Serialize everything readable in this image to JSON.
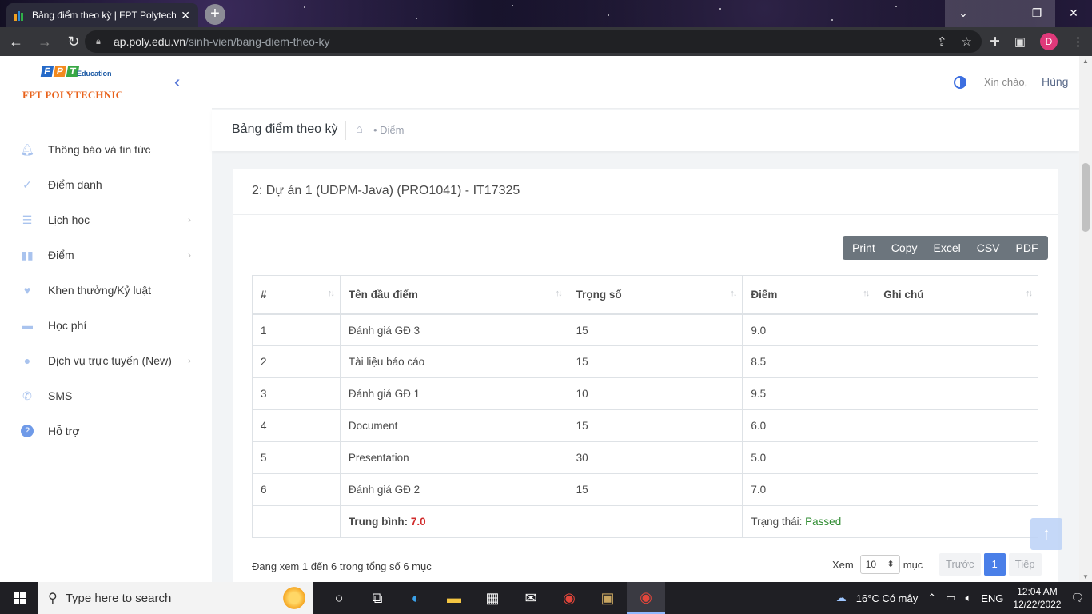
{
  "browser": {
    "tab_title": "Bảng điểm theo kỳ | FPT Polytech",
    "url_host": "ap.poly.edu.vn",
    "url_path": "/sinh-vien/bang-diem-theo-ky",
    "profile_initial": "D"
  },
  "sidebar": {
    "logo_letters": [
      "F",
      "P",
      "T"
    ],
    "logo_education": "Education",
    "logo_text": "FPT POLYTECHNIC",
    "items": [
      {
        "label": "Thông báo và tin tức",
        "icon": "bell-icon",
        "has_submenu": false
      },
      {
        "label": "Điểm danh",
        "icon": "check-icon",
        "has_submenu": false
      },
      {
        "label": "Lịch học",
        "icon": "list-icon",
        "has_submenu": true
      },
      {
        "label": "Điểm",
        "icon": "book-icon",
        "has_submenu": true
      },
      {
        "label": "Khen thưởng/Kỷ luật",
        "icon": "heart-icon",
        "has_submenu": false
      },
      {
        "label": "Học phí",
        "icon": "wallet-icon",
        "has_submenu": false
      },
      {
        "label": "Dịch vụ trực tuyến (New)",
        "icon": "globe-icon",
        "has_submenu": true
      },
      {
        "label": "SMS",
        "icon": "phone-icon",
        "has_submenu": false
      },
      {
        "label": "Hỗ trợ",
        "icon": "help-icon",
        "has_submenu": false
      }
    ]
  },
  "header": {
    "greeting": "Xin chào,",
    "user_name": "Hùng"
  },
  "breadcrumb": {
    "page_title": "Bảng điểm theo kỳ",
    "current": "Điểm"
  },
  "card": {
    "title": "2: Dự án 1 (UDPM-Java) (PRO1041) - IT17325",
    "export_buttons": [
      "Print",
      "Copy",
      "Excel",
      "CSV",
      "PDF"
    ],
    "columns": [
      "#",
      "Tên đầu điểm",
      "Trọng số",
      "Điểm",
      "Ghi chú"
    ],
    "rows": [
      {
        "no": "1",
        "name": "Đánh giá GĐ 3",
        "weight": "15",
        "score": "9.0",
        "note": ""
      },
      {
        "no": "2",
        "name": "Tài liệu báo cáo",
        "weight": "15",
        "score": "8.5",
        "note": ""
      },
      {
        "no": "3",
        "name": "Đánh giá GĐ 1",
        "weight": "10",
        "score": "9.5",
        "note": ""
      },
      {
        "no": "4",
        "name": "Document",
        "weight": "15",
        "score": "6.0",
        "note": ""
      },
      {
        "no": "5",
        "name": "Presentation",
        "weight": "30",
        "score": "5.0",
        "note": ""
      },
      {
        "no": "6",
        "name": "Đánh giá GĐ 2",
        "weight": "15",
        "score": "7.0",
        "note": ""
      }
    ],
    "summary": {
      "average_label": "Trung bình:",
      "average_value": "7.0",
      "status_label": "Trạng thái:",
      "status_value": "Passed"
    },
    "info_text": "Đang xem 1 đến 6 trong tổng số 6 mục",
    "length_prefix": "Xem",
    "length_value": "10",
    "length_suffix": "mục",
    "pagination": {
      "prev": "Trước",
      "current": "1",
      "next": "Tiếp"
    }
  },
  "taskbar": {
    "search_placeholder": "Type here to search",
    "weather": "16°C  Có mây",
    "language": "ENG",
    "time": "12:04 AM",
    "date": "12/22/2022"
  },
  "colors": {
    "accent": "#4a7fe8",
    "average_value": "#d12c2c",
    "status_passed": "#2e8b30",
    "export_buttons_bg": "#6c757d"
  }
}
